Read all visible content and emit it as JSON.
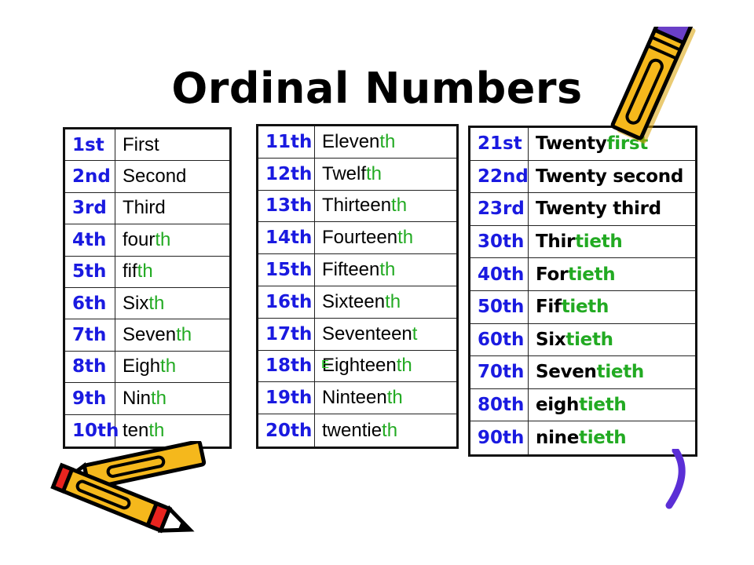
{
  "page": {
    "title": "Ordinal Numbers",
    "background_color": "#ffffff"
  },
  "colors": {
    "number_blue": "#1a1ae0",
    "suffix_green": "#22aa22",
    "text_black": "#000000",
    "border": "#111111",
    "pencil_body": "#f5b81c",
    "pencil_eraser": "#6a3fc7",
    "pencil_tip_red": "#e8241f",
    "swoosh_purple": "#5b2fd6"
  },
  "tables": [
    {
      "id": "units",
      "rows": [
        {
          "number": "1st",
          "stem": "First",
          "suffix": ""
        },
        {
          "number": "2nd",
          "stem": "Second",
          "suffix": ""
        },
        {
          "number": "3rd",
          "stem": "Third",
          "suffix": ""
        },
        {
          "number": "4th",
          "stem": "four",
          "suffix": "th"
        },
        {
          "number": "5th",
          "stem": "fif",
          "suffix": "th"
        },
        {
          "number": "6th",
          "stem": "Six",
          "suffix": "th"
        },
        {
          "number": "7th",
          "stem": "Seven",
          "suffix": "th"
        },
        {
          "number": "8th",
          "stem": "Eigh",
          "suffix": "th"
        },
        {
          "number": "9th",
          "stem": "Nin",
          "suffix": "th"
        },
        {
          "number": "10th",
          "stem": "ten",
          "suffix": "th"
        }
      ]
    },
    {
      "id": "teens",
      "rows": [
        {
          "number": "11th",
          "stem": "Eleven",
          "suffix": "th"
        },
        {
          "number": "12th",
          "stem": "Twelf",
          "suffix": "th"
        },
        {
          "number": "13th",
          "stem": "Thirteen",
          "suffix": "th"
        },
        {
          "number": "14th",
          "stem": "Fourteen",
          "suffix": "th"
        },
        {
          "number": "15th",
          "stem": "Fifteen",
          "suffix": "th"
        },
        {
          "number": "16th",
          "stem": "Sixteen",
          "suffix": "th"
        },
        {
          "number": "17th",
          "stem": "Seventeen",
          "suffix": "t"
        },
        {
          "number": "18th",
          "stem": "Eighteen",
          "suffix": "th"
        },
        {
          "number": "19th",
          "stem": "Ninteen",
          "suffix": "th"
        },
        {
          "number": "20th",
          "stem": "twentie",
          "suffix": "th"
        }
      ]
    },
    {
      "id": "tens",
      "rows": [
        {
          "number": "21st",
          "stem": "Twenty ",
          "suffix": "first"
        },
        {
          "number": "22nd",
          "stem": "Twenty second",
          "suffix": ""
        },
        {
          "number": "23rd",
          "stem": "Twenty third",
          "suffix": ""
        },
        {
          "number": "30th",
          "stem": "Thir",
          "suffix": "tieth"
        },
        {
          "number": "40th",
          "stem": "For",
          "suffix": "tieth"
        },
        {
          "number": "50th",
          "stem": "Fif",
          "suffix": "tieth"
        },
        {
          "number": "60th",
          "stem": "Six",
          "suffix": "tieth"
        },
        {
          "number": "70th",
          "stem": "Seven",
          "suffix": "tieth"
        },
        {
          "number": "80th",
          "stem": "eigh",
          "suffix": "tieth"
        },
        {
          "number": "90th",
          "stem": "nine",
          "suffix": "tieth"
        }
      ]
    }
  ],
  "decorations": [
    {
      "name": "pencil-top-right",
      "kind": "pencil"
    },
    {
      "name": "pencils-bottom-left",
      "kind": "crossed-pencils"
    },
    {
      "name": "purple-swoosh",
      "kind": "curved-stroke"
    }
  ]
}
